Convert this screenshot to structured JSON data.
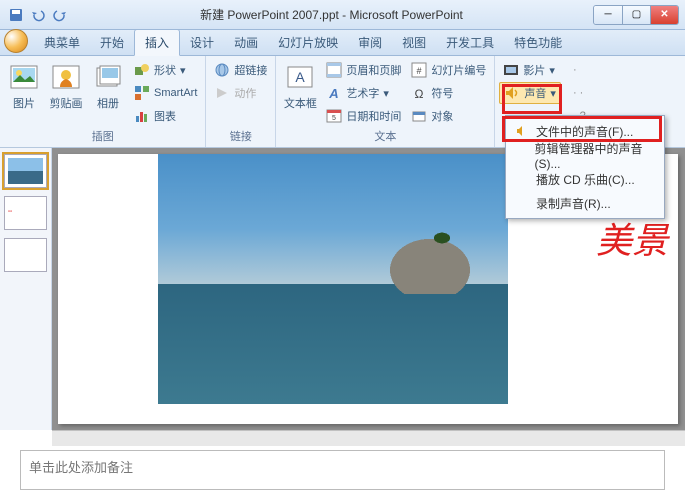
{
  "title": "新建 PowerPoint 2007.ppt - Microsoft PowerPoint",
  "tabs": {
    "classic": "典菜单",
    "home": "开始",
    "insert": "插入",
    "design": "设计",
    "anim": "动画",
    "slideshow": "幻灯片放映",
    "review": "审阅",
    "view": "视图",
    "dev": "开发工具",
    "special": "特色功能"
  },
  "ribbon": {
    "groups": {
      "picture": "图片",
      "clip": "剪贴画",
      "album": "相册",
      "shapes": "形状",
      "smartart": "SmartArt",
      "chart": "图表",
      "illus": "插图",
      "hyperlink": "超链接",
      "action": "动作",
      "links": "链接",
      "textbox": "文本框",
      "headerfooter": "页眉和页脚",
      "wordart": "艺术字",
      "datetime": "日期和时间",
      "slidenumber": "幻灯片编号",
      "symbol": "符号",
      "object": "对象",
      "textgrp": "文本",
      "movie": "影片",
      "sound": "声音"
    }
  },
  "dropdown": {
    "file": "文件中的声音(F)...",
    "clip": "剪辑管理器中的声音(S)...",
    "cd": "播放 CD 乐曲(C)...",
    "record": "录制声音(R)..."
  },
  "slide": {
    "text": "美景"
  },
  "notes": {
    "placeholder": "单击此处添加备注"
  }
}
